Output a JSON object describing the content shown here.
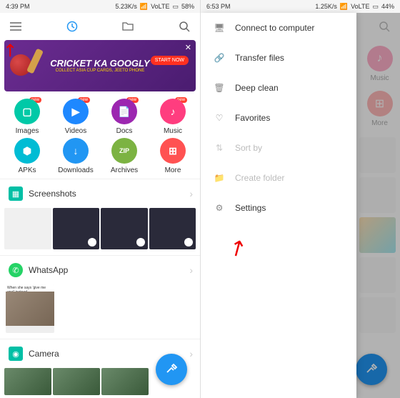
{
  "left": {
    "status": {
      "time": "4:39 PM",
      "speed": "5.23K/s",
      "net": "VoLTE",
      "battery": "58%"
    },
    "banner": {
      "title": "CRICKET KA GOOGLY",
      "sub": "COLLECT ASIA CUP CARDS, JEETO PHONE",
      "cta": "START NOW"
    },
    "grid": [
      {
        "label": "Images",
        "color": "#00c9a7",
        "badge": "new"
      },
      {
        "label": "Videos",
        "color": "#1e88ff",
        "badge": "new"
      },
      {
        "label": "Docs",
        "color": "#9c27b0",
        "badge": "new"
      },
      {
        "label": "Music",
        "color": "#ff3d7f",
        "badge": "new"
      },
      {
        "label": "APKs",
        "color": "#00bcd4",
        "badge": ""
      },
      {
        "label": "Downloads",
        "color": "#2196f3",
        "badge": ""
      },
      {
        "label": "Archives",
        "color": "#7cb342",
        "badge": ""
      },
      {
        "label": "More",
        "color": "#ff5252",
        "badge": ""
      }
    ],
    "sections": {
      "screenshots": "Screenshots",
      "whatsapp": "WhatsApp",
      "camera": "Camera"
    }
  },
  "right": {
    "status": {
      "time": "6:53 PM",
      "speed": "1.25K/s",
      "net": "VoLTE",
      "battery": "44%"
    },
    "drawer": [
      {
        "label": "Connect to computer",
        "icon": "monitor",
        "enabled": true
      },
      {
        "label": "Transfer files",
        "icon": "link",
        "enabled": true
      },
      {
        "label": "Deep clean",
        "icon": "trash",
        "enabled": true
      },
      {
        "label": "Favorites",
        "icon": "heart",
        "enabled": true
      },
      {
        "label": "Sort by",
        "icon": "sort",
        "enabled": false
      },
      {
        "label": "Create folder",
        "icon": "folder",
        "enabled": false
      },
      {
        "label": "Settings",
        "icon": "gear",
        "enabled": true
      }
    ],
    "bg_grid": [
      {
        "label": "Music",
        "color": "#ff3d7f"
      },
      {
        "label": "More",
        "color": "#ff5252"
      }
    ]
  }
}
